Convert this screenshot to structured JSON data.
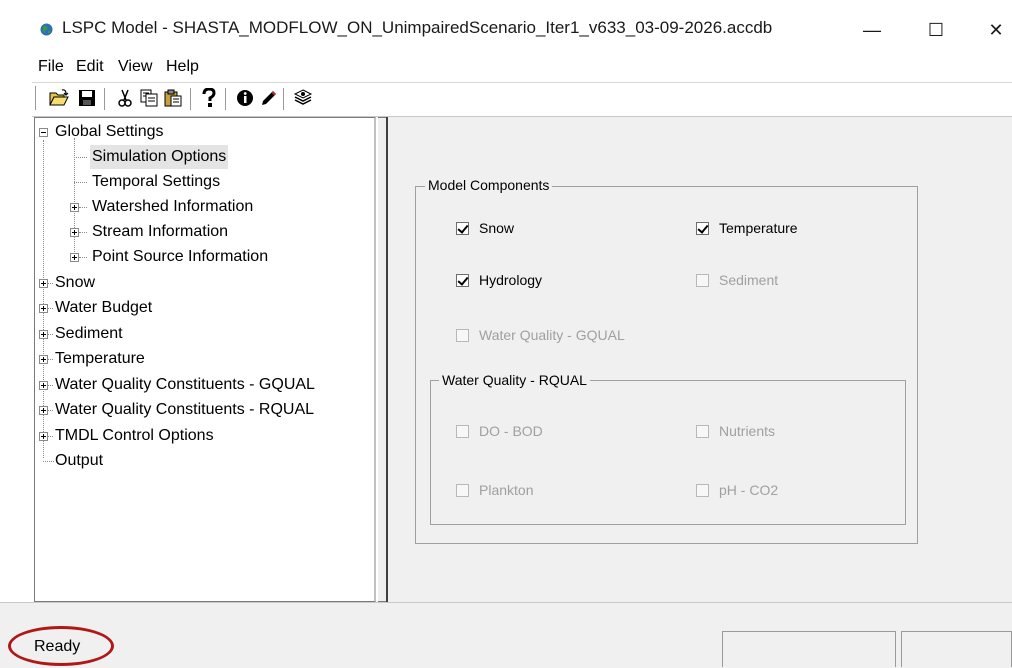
{
  "window": {
    "title": "LSPC Model - SHASTA_MODFLOW_ON_UnimpairedScenario_Iter1_v633_03-09-2026.accdb",
    "app_icon": "globe-icon",
    "controls": {
      "minimize": "—",
      "maximize": "☐",
      "close": "✕"
    }
  },
  "menu": [
    "File",
    "Edit",
    "View",
    "Help"
  ],
  "toolbar": [
    "open-folder-icon",
    "save-disk-icon",
    "cut-scissors-icon",
    "copy-icon",
    "paste-icon",
    "help-question-icon",
    "info-icon",
    "edit-pencil-icon",
    "run-layers-icon"
  ],
  "tree": {
    "items": [
      {
        "label": "Global Settings",
        "level": 0,
        "toggle": "minus"
      },
      {
        "label": "Simulation Options",
        "level": 1,
        "toggle": "none",
        "selected": true
      },
      {
        "label": "Temporal Settings",
        "level": 1,
        "toggle": "none"
      },
      {
        "label": "Watershed Information",
        "level": 1,
        "toggle": "plus"
      },
      {
        "label": "Stream Information",
        "level": 1,
        "toggle": "plus"
      },
      {
        "label": "Point Source Information",
        "level": 1,
        "toggle": "plus"
      },
      {
        "label": "Snow",
        "level": 0,
        "toggle": "plus"
      },
      {
        "label": "Water Budget",
        "level": 0,
        "toggle": "plus"
      },
      {
        "label": "Sediment",
        "level": 0,
        "toggle": "plus"
      },
      {
        "label": "Temperature",
        "level": 0,
        "toggle": "plus"
      },
      {
        "label": "Water Quality Constituents - GQUAL",
        "level": 0,
        "toggle": "plus"
      },
      {
        "label": "Water Quality Constituents - RQUAL",
        "level": 0,
        "toggle": "plus"
      },
      {
        "label": "TMDL Control Options",
        "level": 0,
        "toggle": "plus"
      },
      {
        "label": "Output",
        "level": 0,
        "toggle": "none"
      }
    ]
  },
  "model_components": {
    "title": "Model Components",
    "snow": {
      "label": "Snow",
      "checked": true,
      "enabled": true
    },
    "temperature": {
      "label": "Temperature",
      "checked": true,
      "enabled": true
    },
    "hydrology": {
      "label": "Hydrology",
      "checked": true,
      "enabled": true
    },
    "sediment": {
      "label": "Sediment",
      "checked": false,
      "enabled": false
    },
    "gqual": {
      "label": "Water Quality - GQUAL",
      "checked": false,
      "enabled": false
    },
    "rqual": {
      "title": "Water Quality - RQUAL",
      "do_bod": {
        "label": "DO - BOD",
        "checked": false,
        "enabled": false
      },
      "nutrients": {
        "label": "Nutrients",
        "checked": false,
        "enabled": false
      },
      "plankton": {
        "label": "Plankton",
        "checked": false,
        "enabled": false
      },
      "ph_co2": {
        "label": "pH - CO2",
        "checked": false,
        "enabled": false
      }
    }
  },
  "status": {
    "text": "Ready",
    "highlight_color": "#b01818"
  }
}
